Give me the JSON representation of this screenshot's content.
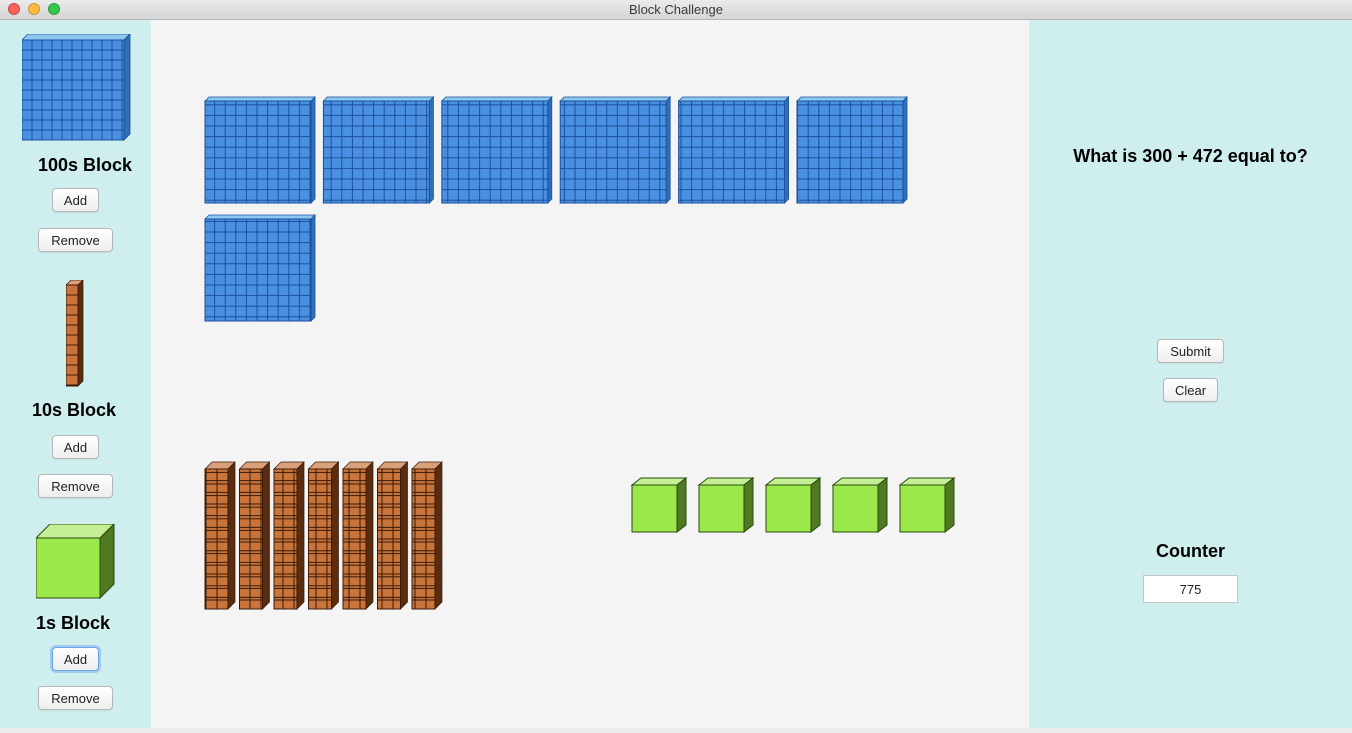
{
  "window": {
    "title": "Block Challenge"
  },
  "left_panel": {
    "hundreds": {
      "label": "100s Block",
      "add": "Add",
      "remove": "Remove"
    },
    "tens": {
      "label": "10s Block",
      "add": "Add",
      "remove": "Remove"
    },
    "ones": {
      "label": "1s Block",
      "add": "Add",
      "remove": "Remove"
    }
  },
  "workspace": {
    "hundreds_count": 7,
    "tens_count": 7,
    "ones_count": 5
  },
  "right_panel": {
    "question": "What is 300 + 472 equal to?",
    "submit": "Submit",
    "clear": "Clear",
    "counter_label": "Counter",
    "counter_value": "775"
  },
  "colors": {
    "panel_bg": "#cfefee",
    "workspace_bg": "#f4f4f4",
    "hundreds_blue": "#4a90e2",
    "tens_brown": "#c8743a",
    "ones_green": "#9be84a"
  },
  "icons": {
    "hundreds": "hundred-block-icon",
    "tens": "ten-rod-icon",
    "ones": "unit-cube-icon"
  }
}
